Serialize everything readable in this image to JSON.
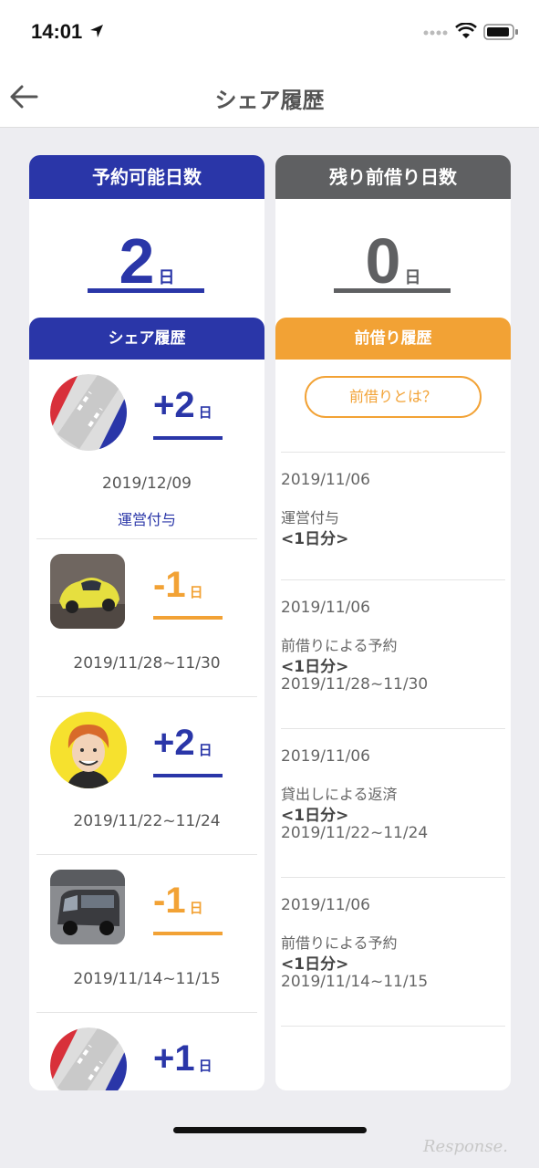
{
  "status_bar": {
    "time": "14:01"
  },
  "nav": {
    "title": "シェア履歴"
  },
  "left": {
    "header": "予約可能日数",
    "count": "2",
    "unit": "日",
    "history_header": "シェア履歴",
    "items": [
      {
        "sign_num": "+2",
        "unit": "日",
        "date": "2019/12/09",
        "tag": "運営付与"
      },
      {
        "sign_num": "-1",
        "unit": "日",
        "date": "2019/11/28~11/30"
      },
      {
        "sign_num": "+2",
        "unit": "日",
        "date": "2019/11/22~11/24"
      },
      {
        "sign_num": "-1",
        "unit": "日",
        "date": "2019/11/14~11/15"
      },
      {
        "sign_num": "+1",
        "unit": "日"
      }
    ]
  },
  "right": {
    "header": "残り前借り日数",
    "count": "0",
    "unit": "日",
    "history_header": "前借り履歴",
    "about_button": "前借りとは？",
    "items": [
      {
        "date": "2019/11/06",
        "type": "運営付与",
        "amount": "<1日分>"
      },
      {
        "date": "2019/11/06",
        "type": "前借りによる予約",
        "amount": "<1日分>",
        "range": "2019/11/28~11/30"
      },
      {
        "date": "2019/11/06",
        "type": "貸出しによる返済",
        "amount": "<1日分>",
        "range": "2019/11/22~11/24"
      },
      {
        "date": "2019/11/06",
        "type": "前借りによる予約",
        "amount": "<1日分>",
        "range": "2019/11/14~11/15"
      }
    ]
  },
  "watermark": "Response.",
  "colors": {
    "blue": "#2a36a8",
    "orange": "#f2a235",
    "gray": "#5f6062"
  }
}
